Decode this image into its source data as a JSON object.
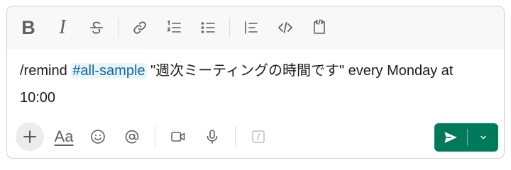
{
  "toolbar": {
    "bold_label": "B",
    "italic_label": "I",
    "icons": [
      "strikethrough-icon",
      "link-icon",
      "numbered-list-icon",
      "bulleted-list-icon",
      "blockquote-icon",
      "code-icon",
      "code-block-icon"
    ]
  },
  "editor": {
    "text_before": "/remind ",
    "mention": "#all-sample",
    "text_after": " \"週次ミーティングの時間です\" every Monday at 10:00"
  },
  "bottom": {
    "format_label": "Aa",
    "icons": [
      "plus-icon",
      "emoji-icon",
      "mention-icon",
      "video-icon",
      "microphone-icon",
      "slash-command-icon"
    ]
  },
  "colors": {
    "send": "#007a5a",
    "mention_text": "#1264a3",
    "mention_bg": "#e8f5fa",
    "icon": "#616061"
  }
}
